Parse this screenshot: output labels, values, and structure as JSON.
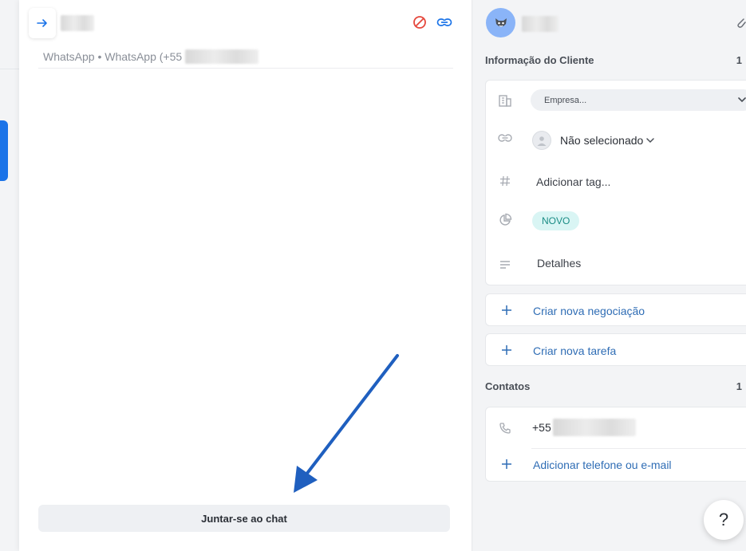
{
  "chat": {
    "channel_text": "WhatsApp • WhatsApp (+55",
    "join_button_label": "Juntar-se ao chat"
  },
  "side": {
    "client_section": {
      "title": "Informação do Cliente",
      "count": "1"
    },
    "company_select": {
      "placeholder": "Empresa..."
    },
    "responsible": {
      "label": "Não selecionado"
    },
    "tags": {
      "placeholder": "Adicionar tag..."
    },
    "stage": {
      "badge": "NOVO"
    },
    "details": {
      "label": "Detalhes"
    },
    "create_deal": {
      "label": "Criar nova negociação"
    },
    "create_task": {
      "label": "Criar nova tarefa"
    },
    "contacts_section": {
      "title": "Contatos",
      "count": "1"
    },
    "phone": {
      "prefix": "+55"
    },
    "add_contact": {
      "label": "Adicionar telefone ou e-mail"
    }
  },
  "help": {
    "label": "?"
  },
  "colors": {
    "accent_blue": "#1a73e8",
    "link_blue": "#2f6db5",
    "block_red": "#e5483d",
    "badge_bg": "#d9f5f4",
    "badge_text": "#1a8c85"
  },
  "icons": [
    "arrow-right-icon",
    "block-icon",
    "link-icon",
    "paperclip-icon",
    "building-icon",
    "hash-icon",
    "pie-chart-icon",
    "lines-icon",
    "plus-icon",
    "phone-icon",
    "chevron-down-icon",
    "user-icon"
  ]
}
